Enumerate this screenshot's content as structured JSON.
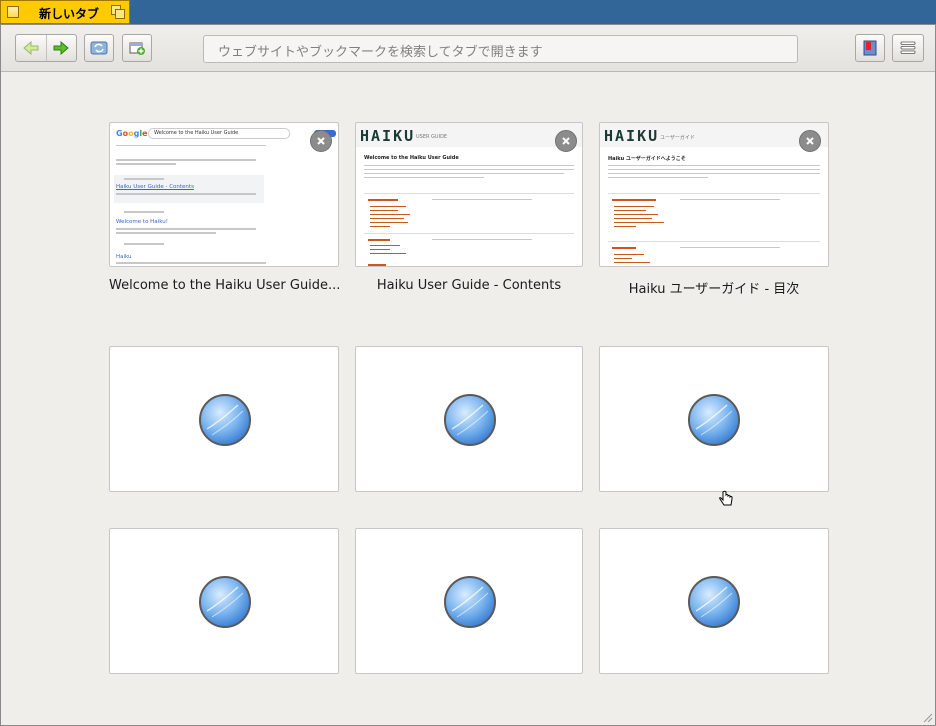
{
  "window": {
    "title": "新しいタブ"
  },
  "toolbar": {
    "back_icon": "back-arrow-icon",
    "forward_icon": "forward-arrow-icon",
    "reload_icon": "reload-icon",
    "new_tab_icon": "new-tab-icon",
    "search_placeholder": "ウェブサイトやブックマークを検索してタブで開きます",
    "bookmark_icon": "bookmark-icon",
    "menu_icon": "hamburger-menu-icon"
  },
  "speed_dial": {
    "thumbnails": [
      {
        "caption": "Welcome to the Haiku User Guide...",
        "preview": {
          "logo": "Google",
          "query": "Welcome to the Haiku User Guide",
          "result_title": "Haiku User Guide - Contents",
          "result_title2": "Welcome to Haiku!",
          "result_title3": "Haiku"
        }
      },
      {
        "caption": "Haiku User Guide - Contents",
        "preview": {
          "logo": "HAIKU",
          "subtitle": "USER GUIDE",
          "heading": "Welcome to the Haiku User Guide"
        }
      },
      {
        "caption": "Haiku ユーザーガイド - 目次",
        "preview": {
          "logo": "HAIKU",
          "subtitle": "ユーザーガイド",
          "heading": "Haiku ユーザーガイドへようこそ"
        }
      }
    ],
    "empty_slots": 6,
    "empty_icon": "globe-icon"
  },
  "colors": {
    "tab_yellow": "#ffcb00",
    "desktop_blue": "#336698",
    "haiku_orange": "#c8581b",
    "link_blue": "#3767c9"
  }
}
